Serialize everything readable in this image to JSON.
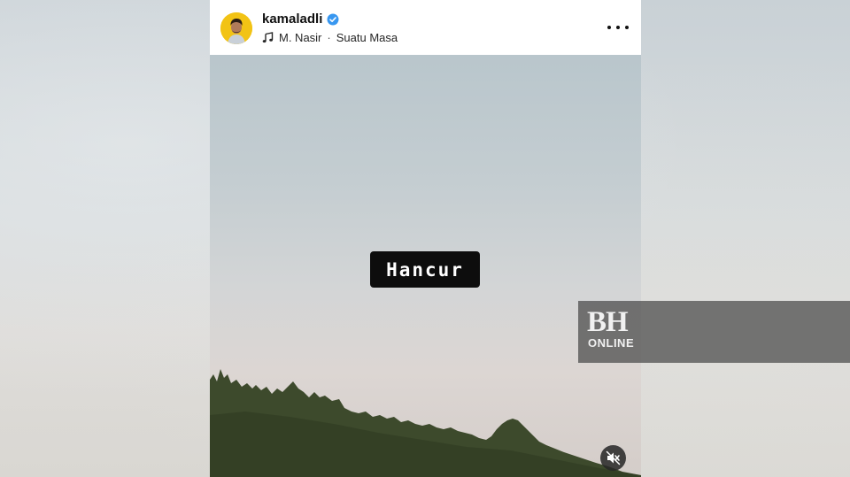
{
  "post": {
    "username": "kamaladli",
    "verified": true,
    "audio": {
      "artist": "M. Nasir",
      "separator": "·",
      "track": "Suatu Masa"
    },
    "more_icon": "more-horizontal-icon"
  },
  "video": {
    "caption": "Hancur",
    "muted": true,
    "mute_icon": "speaker-muted-icon"
  },
  "watermark": {
    "brand_main": "BH",
    "brand_sub": "ONLINE"
  },
  "colors": {
    "verified_badge": "#3897f0",
    "avatar_ring": "#f2c315",
    "caption_bg": "#0d0d0d"
  }
}
